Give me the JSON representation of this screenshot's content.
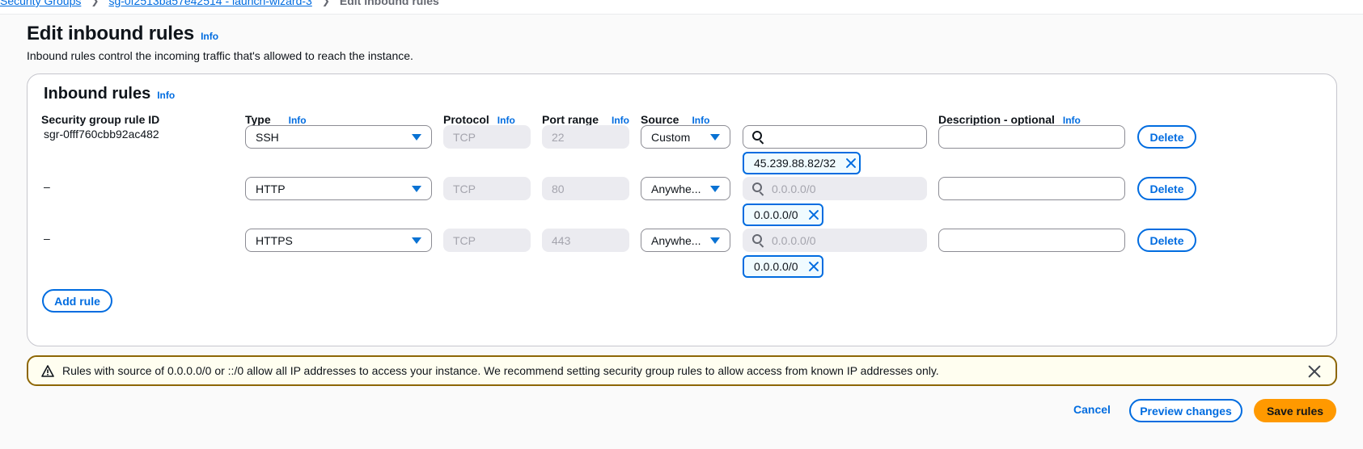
{
  "breadcrumb": {
    "items": [
      "Security Groups",
      "sg-0f2513ba57e42514 - launch-wizard-3"
    ],
    "current": "Edit inbound rules"
  },
  "page": {
    "title": "Edit inbound rules",
    "info": "Info",
    "description": "Inbound rules control the incoming traffic that's allowed to reach the instance."
  },
  "container": {
    "title": "Inbound rules",
    "info": "Info",
    "columns": {
      "rule_id": "Security group rule ID",
      "type": "Type",
      "protocol": "Protocol",
      "port_range": "Port range",
      "source": "Source",
      "description": "Description - optional",
      "info": "Info"
    }
  },
  "rules": [
    {
      "id": "sgr-0fff760cbb92ac482",
      "type": "SSH",
      "protocol": "TCP",
      "port": "22",
      "source": "Custom",
      "search_placeholder": "",
      "token": "45.239.88.82/32",
      "delete": "Delete"
    },
    {
      "id": "–",
      "type": "HTTP",
      "protocol": "TCP",
      "port": "80",
      "source": "Anywhe...",
      "search_placeholder": "0.0.0.0/0",
      "token": "0.0.0.0/0",
      "delete": "Delete"
    },
    {
      "id": "–",
      "type": "HTTPS",
      "protocol": "TCP",
      "port": "443",
      "source": "Anywhe...",
      "search_placeholder": "0.0.0.0/0",
      "token": "0.0.0.0/0",
      "delete": "Delete"
    }
  ],
  "add_rule": "Add rule",
  "warning": {
    "text": "Rules with source of 0.0.0.0/0 or ::/0 allow all IP addresses to access your instance. We recommend setting security group rules to allow access from known IP addresses only."
  },
  "actions": {
    "cancel": "Cancel",
    "preview": "Preview changes",
    "save": "Save rules"
  },
  "colors": {
    "link": "#006ce0",
    "primary": "#ff9900",
    "warning_border": "#8d6605",
    "warning_bg": "#fffef0"
  }
}
